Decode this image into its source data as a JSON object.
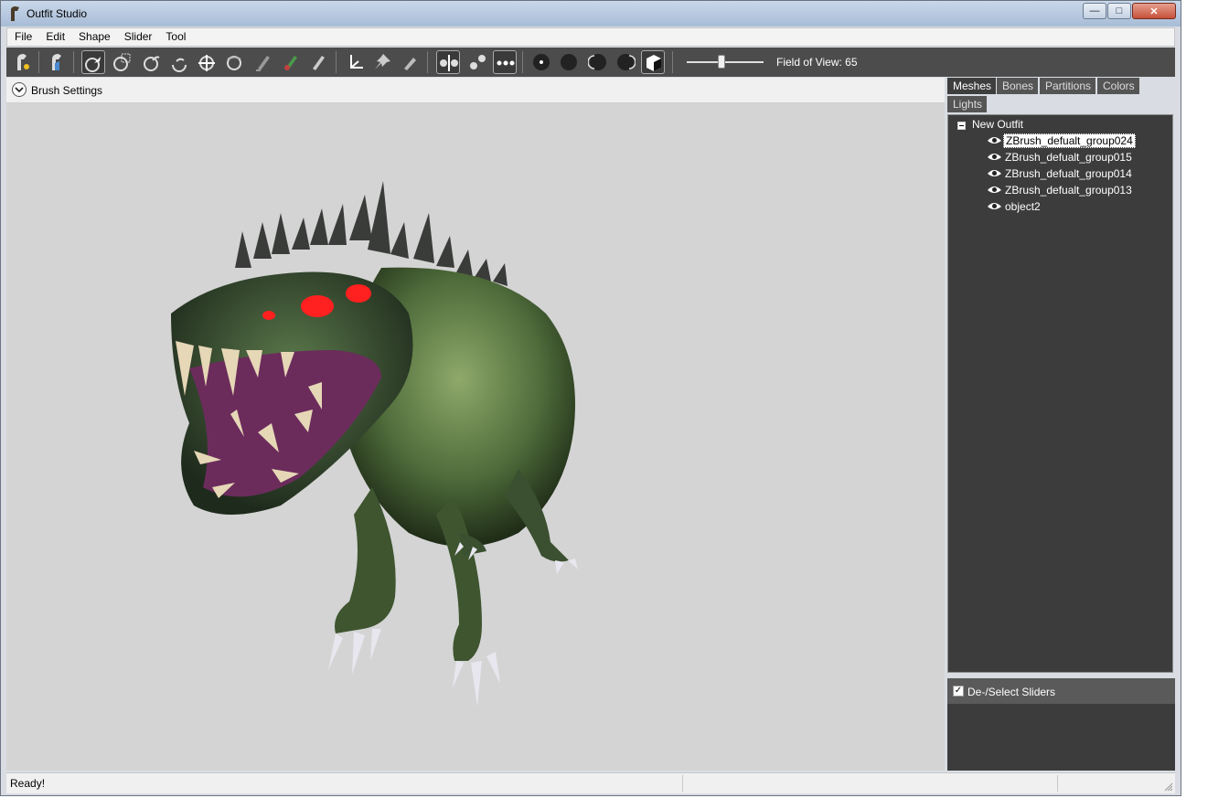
{
  "window": {
    "title": "Outfit Studio"
  },
  "menu": {
    "items": [
      "File",
      "Edit",
      "Shape",
      "Slider",
      "Tool"
    ]
  },
  "toolbar": {
    "fov_label": "Field of View: 65",
    "fov_value_fraction": 0.45
  },
  "brush_settings": {
    "label": "Brush Settings"
  },
  "side_tabs": [
    "Meshes",
    "Bones",
    "Partitions",
    "Colors",
    "Lights"
  ],
  "mesh_tree": {
    "root": "New Outfit",
    "items": [
      "ZBrush_defualt_group024",
      "ZBrush_defualt_group015",
      "ZBrush_defualt_group014",
      "ZBrush_defualt_group013",
      "object2"
    ]
  },
  "sliders": {
    "label": "De-/Select Sliders",
    "checked": true
  },
  "status": {
    "text": "Ready!"
  },
  "colors": {
    "toolbar_bg": "#4c4c4c",
    "panel_bg": "#3c3c3c",
    "viewport_bg": "#d4d4d4"
  }
}
